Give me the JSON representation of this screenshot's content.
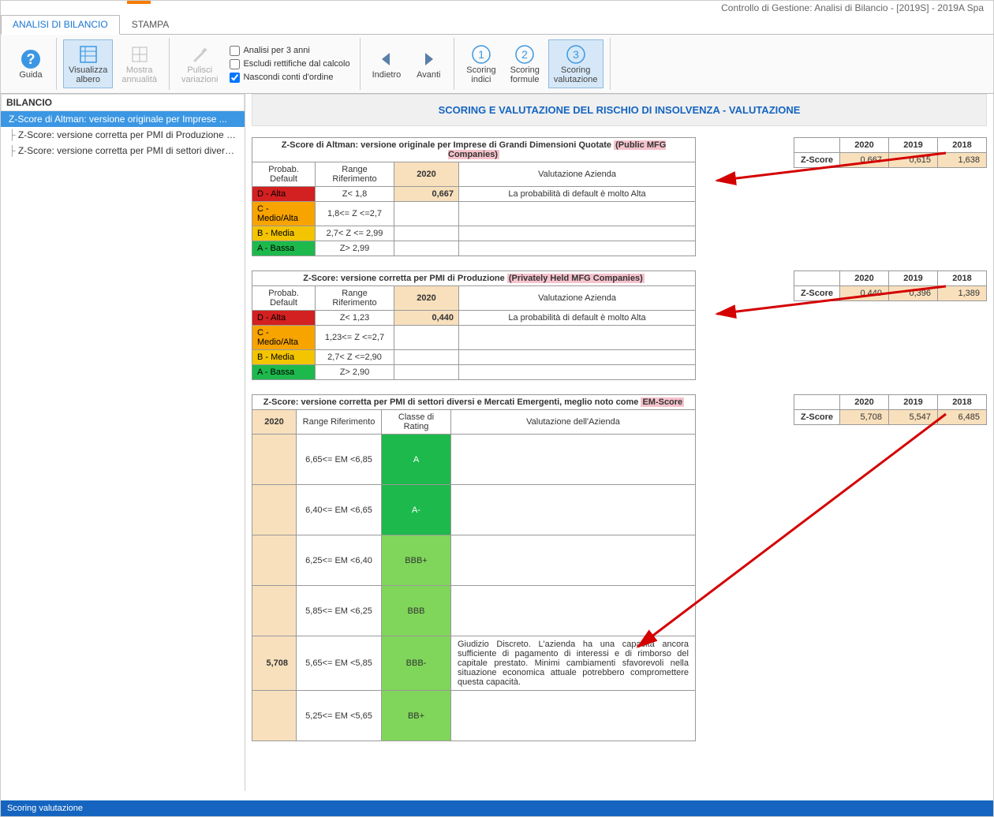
{
  "window": {
    "title": "Controllo di Gestione: Analisi di Bilancio - [2019S] - 2019A Spa"
  },
  "tabs": {
    "analisi": "ANALISI DI BILANCIO",
    "stampa": "STAMPA"
  },
  "ribbon": {
    "guida": "Guida",
    "visualizza": "Visualizza\nalbero",
    "mostra": "Mostra\nannualità",
    "pulisci": "Pulisci\nvariazioni",
    "chk1": "Analisi per 3 anni",
    "chk2": "Escludi rettifiche dal calcolo",
    "chk3": "Nascondi conti d'ordine",
    "indietro": "Indietro",
    "avanti": "Avanti",
    "scoring_indici": "Scoring\nindici",
    "scoring_formule": "Scoring\nformule",
    "scoring_val": "Scoring\nvalutazione"
  },
  "sidebar": {
    "head": "BILANCIO",
    "items": [
      "Z-Score di Altman: versione originale per Imprese ...",
      "Z-Score: versione corretta per PMI di Produzione (...",
      "Z-Score: versione corretta per PMI di settori diversi..."
    ]
  },
  "page_title": "SCORING E VALUTAZIONE DEL RISCHIO DI INSOLVENZA - VALUTAZIONE",
  "block1": {
    "title_a": "Z-Score di Altman: versione originale per Imprese di Grandi Dimensioni Quotate ",
    "title_b": "(Public MFG Companies)",
    "h_prob": "Probab. Default",
    "h_range": "Range Riferimento",
    "h_year": "2020",
    "h_val": "Valutazione Azienda",
    "rows": [
      {
        "p": "D - Alta",
        "r": "Z< 1,8",
        "v": "0,667",
        "e": "La probabilità di default è molto Alta",
        "cls": "red"
      },
      {
        "p": "C - Medio/Alta",
        "r": "1,8<= Z <=2,7",
        "v": "",
        "e": "",
        "cls": "orange"
      },
      {
        "p": "B - Media",
        "r": "2,7< Z <= 2,99",
        "v": "",
        "e": "",
        "cls": "yellow"
      },
      {
        "p": "A - Bassa",
        "r": "Z> 2,99",
        "v": "",
        "e": "",
        "cls": "green"
      }
    ],
    "side": {
      "label": "Z-Score",
      "y1": "2020",
      "y2": "2019",
      "y3": "2018",
      "v1": "0,667",
      "v2": "0,615",
      "v3": "1,638"
    }
  },
  "block2": {
    "title_a": "Z-Score: versione corretta per PMI di Produzione ",
    "title_b": "(Privately Held MFG Companies)",
    "h_prob": "Probab. Default",
    "h_range": "Range Riferimento",
    "h_year": "2020",
    "h_val": "Valutazione Azienda",
    "rows": [
      {
        "p": "D - Alta",
        "r": "Z< 1,23",
        "v": "0,440",
        "e": "La probabilità di default è molto Alta",
        "cls": "red"
      },
      {
        "p": "C - Medio/Alta",
        "r": "1,23<= Z <=2,7",
        "v": "",
        "e": "",
        "cls": "orange"
      },
      {
        "p": "B - Media",
        "r": "2,7< Z <=2,90",
        "v": "",
        "e": "",
        "cls": "yellow"
      },
      {
        "p": "A - Bassa",
        "r": "Z> 2,90",
        "v": "",
        "e": "",
        "cls": "green"
      }
    ],
    "side": {
      "label": "Z-Score",
      "y1": "2020",
      "y2": "2019",
      "y3": "2018",
      "v1": "0,440",
      "v2": "0,396",
      "v3": "1,389"
    }
  },
  "block3": {
    "title_a": "Z-Score: versione corretta per PMI di settori diversi  e Mercati Emergenti, meglio noto come ",
    "title_b": "EM-Score",
    "h_year": "2020",
    "h_range": "Range Riferimento",
    "h_rating": "Classe di Rating",
    "h_val": "Valutazione dell'Azienda",
    "rows": [
      {
        "y": "",
        "r": "6,65<= EM <6,85",
        "rt": "A",
        "e": "",
        "rcls": "rating-g1"
      },
      {
        "y": "",
        "r": "6,40<= EM <6,65",
        "rt": "A-",
        "e": "",
        "rcls": "rating-g1"
      },
      {
        "y": "",
        "r": "6,25<= EM <6,40",
        "rt": "BBB+",
        "e": "",
        "rcls": "rating-g2"
      },
      {
        "y": "",
        "r": "5,85<= EM <6,25",
        "rt": "BBB",
        "e": "",
        "rcls": "rating-g2"
      },
      {
        "y": "5,708",
        "r": "5,65<= EM <5,85",
        "rt": "BBB-",
        "e": "Giudizio Discreto. L'azienda ha una capacità ancora sufficiente di pagamento di interessi e di rimborso del capitale prestato. Minimi cambiamenti sfavorevoli nella situazione economica attuale potrebbero compromettere questa capacità.",
        "rcls": "rating-g2"
      },
      {
        "y": "",
        "r": "5,25<= EM <5,65",
        "rt": "BB+",
        "e": "",
        "rcls": "rating-g2"
      }
    ],
    "side": {
      "label": "Z-Score",
      "y1": "2020",
      "y2": "2019",
      "y3": "2018",
      "v1": "5,708",
      "v2": "5,547",
      "v3": "6,485"
    }
  },
  "status": "Scoring valutazione",
  "chart_data": [
    {
      "type": "table",
      "title": "Z-Score Altman (Public MFG)",
      "categories": [
        "2020",
        "2019",
        "2018"
      ],
      "values": [
        0.667,
        0.615,
        1.638
      ]
    },
    {
      "type": "table",
      "title": "Z-Score PMI Produzione (Privately Held MFG)",
      "categories": [
        "2020",
        "2019",
        "2018"
      ],
      "values": [
        0.44,
        0.396,
        1.389
      ]
    },
    {
      "type": "table",
      "title": "EM-Score",
      "categories": [
        "2020",
        "2019",
        "2018"
      ],
      "values": [
        5.708,
        5.547,
        6.485
      ]
    }
  ]
}
